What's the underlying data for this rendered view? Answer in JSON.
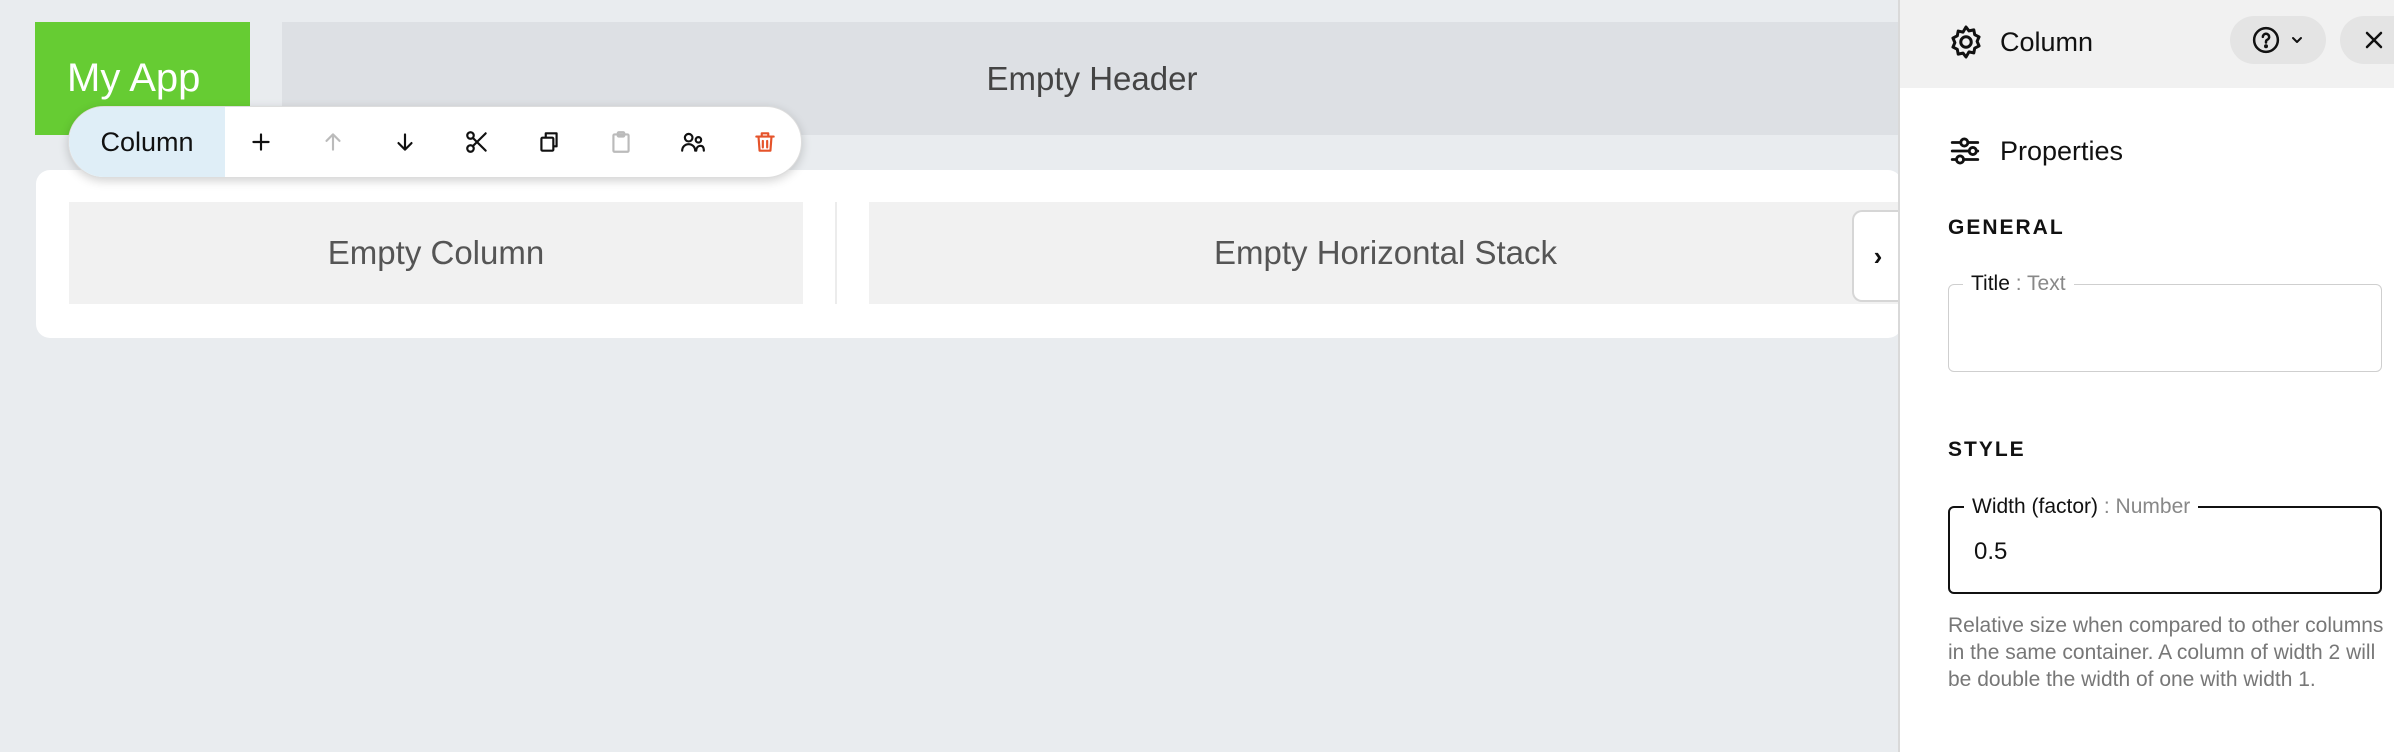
{
  "app": {
    "logo_text": "My App"
  },
  "canvas": {
    "header_text": "Empty Header",
    "column_text": "Empty Column",
    "hstack_text": "Empty Horizontal Stack",
    "expand_glyph": "›"
  },
  "toolbar": {
    "label": "Column",
    "buttons": [
      {
        "name": "add-icon",
        "enabled": true
      },
      {
        "name": "arrow-up-icon",
        "enabled": false
      },
      {
        "name": "arrow-down-icon",
        "enabled": true
      },
      {
        "name": "scissors-icon",
        "enabled": true
      },
      {
        "name": "copy-icon",
        "enabled": true
      },
      {
        "name": "paste-icon",
        "enabled": false
      },
      {
        "name": "users-icon",
        "enabled": true
      },
      {
        "name": "trash-icon",
        "enabled": true,
        "color": "#e5532a"
      }
    ]
  },
  "panel": {
    "title": "Column",
    "properties_label": "Properties",
    "general_label": "GENERAL",
    "style_label": "STYLE",
    "title_field": {
      "label": "Title",
      "sep": " : ",
      "type": "Text",
      "value": ""
    },
    "width_field": {
      "label": "Width (factor)",
      "sep": " : ",
      "type": "Number",
      "value": "0.5"
    },
    "width_help": "Relative size when compared to other columns in the same container. A column of width 2 will be double the width of one with width 1."
  },
  "colors": {
    "logo_bg": "#66cc33",
    "canvas_bg": "#e9ecef",
    "toolbar_label_bg": "#dfeef7",
    "delete": "#e5532a"
  }
}
